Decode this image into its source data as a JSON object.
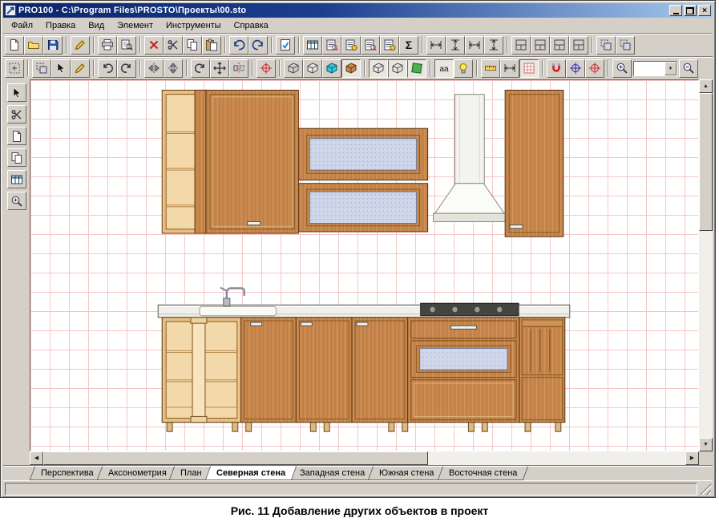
{
  "window": {
    "title": "PRO100 - C:\\Program Files\\PROSTO\\Проекты\\00.sto",
    "buttons": {
      "close": "×"
    }
  },
  "menu": {
    "items": [
      {
        "id": "file",
        "label": "Файл"
      },
      {
        "id": "edit",
        "label": "Правка"
      },
      {
        "id": "view",
        "label": "Вид"
      },
      {
        "id": "element",
        "label": "Элемент"
      },
      {
        "id": "tools",
        "label": "Инструменты"
      },
      {
        "id": "help",
        "label": "Справка"
      }
    ]
  },
  "toolbars": {
    "standard": [
      {
        "name": "new-button",
        "icon": "i-page"
      },
      {
        "name": "open-button",
        "icon": "i-folder"
      },
      {
        "name": "save-button",
        "icon": "i-disk"
      },
      {
        "sep": true
      },
      {
        "name": "properties-button",
        "icon": "i-pencil"
      },
      {
        "sep": true
      },
      {
        "name": "print-button",
        "icon": "i-printer"
      },
      {
        "name": "print-preview-button",
        "icon": "i-preview"
      },
      {
        "sep": true
      },
      {
        "name": "delete-button",
        "icon": "i-cross"
      },
      {
        "name": "cut-button",
        "icon": "i-scissors"
      },
      {
        "name": "copy-button",
        "icon": "i-copy"
      },
      {
        "name": "paste-button",
        "icon": "i-paste"
      },
      {
        "sep": true
      },
      {
        "name": "undo-button",
        "icon": "i-undo"
      },
      {
        "name": "redo-button",
        "icon": "i-redo"
      },
      {
        "sep": true
      },
      {
        "name": "element-properties-button",
        "icon": "i-check"
      },
      {
        "sep": true
      },
      {
        "name": "report-button",
        "icon": "i-table"
      },
      {
        "name": "report-preview-button",
        "icon": "i-table2"
      },
      {
        "name": "price-list-button",
        "icon": "i-table3"
      },
      {
        "name": "cutting-list-button",
        "icon": "i-table2"
      },
      {
        "name": "materials-list-button",
        "icon": "i-table3"
      },
      {
        "name": "summary-button",
        "icon": "i-sigma"
      },
      {
        "sep": true
      },
      {
        "name": "dimension-width-button",
        "icon": "i-dimh"
      },
      {
        "name": "dimension-height-button",
        "icon": "i-dimv"
      },
      {
        "name": "dimension-depth-button",
        "icon": "i-dimh"
      },
      {
        "name": "dimension-auto-button",
        "icon": "i-dimv"
      },
      {
        "sep": true
      },
      {
        "name": "arrange-left-button",
        "icon": "i-shelf"
      },
      {
        "name": "arrange-right-button",
        "icon": "i-shelf"
      },
      {
        "name": "arrange-top-button",
        "icon": "i-shelf"
      },
      {
        "name": "arrange-bottom-button",
        "icon": "i-shelf"
      },
      {
        "sep": true
      },
      {
        "name": "group-button",
        "icon": "i-group"
      },
      {
        "name": "ungroup-button",
        "icon": "i-group"
      }
    ],
    "tools": [
      {
        "name": "snap-grid-button",
        "icon": "i-dotted"
      },
      {
        "sep": true
      },
      {
        "name": "insert-element-button",
        "icon": "i-group"
      },
      {
        "name": "select-tool-button",
        "icon": "i-arrow"
      },
      {
        "name": "edit-tool-button",
        "icon": "i-pencil"
      },
      {
        "sep": true
      },
      {
        "name": "rotate-left-button",
        "icon": "i-rotl"
      },
      {
        "name": "rotate-right-button",
        "icon": "i-rotr"
      },
      {
        "sep": true
      },
      {
        "name": "flip-horizontal-button",
        "icon": "i-fliph"
      },
      {
        "name": "flip-vertical-button",
        "icon": "i-flipv"
      },
      {
        "sep": true
      },
      {
        "name": "rotate-button",
        "icon": "i-rotr"
      },
      {
        "name": "move-button",
        "icon": "i-move"
      },
      {
        "name": "mirror-button",
        "icon": "i-mirror"
      },
      {
        "sep": true
      },
      {
        "name": "center-point-button",
        "icon": "i-targetred"
      },
      {
        "sep": true
      },
      {
        "name": "view-wireframe-button",
        "icon": "i-cubewire"
      },
      {
        "name": "view-sketch-button",
        "icon": "i-cubehidden"
      },
      {
        "name": "view-color-button",
        "icon": "i-cubecolor"
      },
      {
        "name": "view-texture-button",
        "icon": "i-cubetex",
        "pressed": true
      },
      {
        "sep": true
      },
      {
        "name": "show-contours-button",
        "icon": "i-cubewire",
        "pressed": true
      },
      {
        "name": "show-edges-button",
        "icon": "i-cubehidden",
        "pressed": true
      },
      {
        "name": "show-surface-button",
        "icon": "i-panel",
        "pressed": true
      },
      {
        "sep": true
      },
      {
        "name": "text-labels-button",
        "icon": "i-aa",
        "pressed": true
      },
      {
        "name": "light-button",
        "icon": "i-bulb"
      },
      {
        "sep": true
      },
      {
        "name": "measure-button",
        "icon": "i-ruler"
      },
      {
        "name": "dimensions-button",
        "icon": "i-dimh"
      },
      {
        "name": "grid-button",
        "icon": "i-grid",
        "pressed": true
      },
      {
        "sep": true
      },
      {
        "name": "magnet-button",
        "icon": "i-magnet"
      },
      {
        "name": "snap-center-button",
        "icon": "i-targetblue"
      },
      {
        "name": "snap-point-button",
        "icon": "i-targetred"
      },
      {
        "sep": true
      },
      {
        "name": "zoom-in-button",
        "icon": "i-zoomin"
      },
      {
        "zoombox": true
      },
      {
        "name": "zoom-out-button",
        "icon": "i-zoomout"
      }
    ],
    "palette": [
      {
        "name": "pointer-tool-button",
        "icon": "i-arrow"
      },
      {
        "name": "section-tool-button",
        "icon": "i-scissors"
      },
      {
        "name": "sheet-tool-button",
        "icon": "i-page"
      },
      {
        "name": "duplicate-tool-button",
        "icon": "i-copy"
      },
      {
        "name": "layout-tool-button",
        "icon": "i-table"
      },
      {
        "name": "zoom-area-tool-button",
        "icon": "i-zoomin"
      }
    ]
  },
  "zoom": {
    "value": ""
  },
  "glyphs": {
    "up": "▲",
    "down": "▼",
    "left": "◀",
    "right": "▶"
  },
  "view_tabs": [
    {
      "id": "perspective",
      "label": "Перспектива",
      "active": false
    },
    {
      "id": "axonometry",
      "label": "Аксонометрия",
      "active": false
    },
    {
      "id": "plan",
      "label": "План",
      "active": false
    },
    {
      "id": "north-wall",
      "label": "Северная стена",
      "active": true
    },
    {
      "id": "west-wall",
      "label": "Западная стена",
      "active": false
    },
    {
      "id": "south-wall",
      "label": "Южная стена",
      "active": false
    },
    {
      "id": "east-wall",
      "label": "Восточная стена",
      "active": false
    }
  ],
  "caption": "Рис. 11   Добавление других объектов в проект"
}
